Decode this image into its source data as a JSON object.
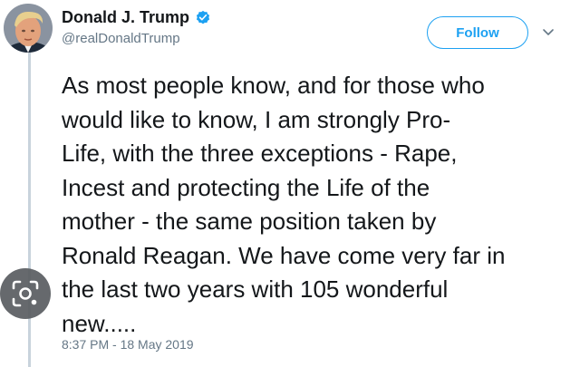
{
  "tweet": {
    "author": {
      "display_name": "Donald J. Trump",
      "handle": "@realDonaldTrump",
      "verified": true
    },
    "follow_label": "Follow",
    "text": "As most people know, and for those who\nwould like to know, I am strongly Pro-\nLife, with the three exceptions - Rape,\nIncest and protecting the Life of the\nmother - the same position taken by\nRonald Reagan. We have come very far in\nthe last two years with 105 wonderful\nnew.....",
    "timestamp": "8:37 PM - 18 May 2019"
  },
  "colors": {
    "accent": "#1da1f2",
    "text_primary": "#14171a",
    "text_secondary": "#657786",
    "thread_line": "#c8d3dc",
    "lens_overlay": "#5a5d61"
  },
  "icons": {
    "verified": "verified-badge-icon",
    "menu": "chevron-down-icon",
    "lens": "visual-search-lens-icon",
    "avatar": "avatar-portrait"
  }
}
